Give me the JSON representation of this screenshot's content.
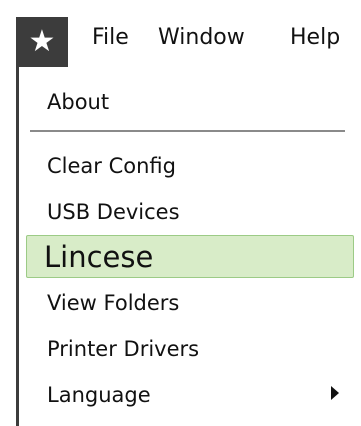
{
  "menubar": {
    "app_icon": "star-icon",
    "items": [
      {
        "label": "File"
      },
      {
        "label": "Window"
      },
      {
        "label": "Help"
      }
    ]
  },
  "dropdown": {
    "items": [
      {
        "label": "About"
      },
      {
        "label": "Clear Config"
      },
      {
        "label": "USB Devices"
      },
      {
        "label": "Lincese",
        "highlighted": true
      },
      {
        "label": "View Folders"
      },
      {
        "label": "Printer Drivers"
      },
      {
        "label": "Language",
        "has_submenu": true
      }
    ],
    "highlight_color": "#d8ecc8"
  }
}
